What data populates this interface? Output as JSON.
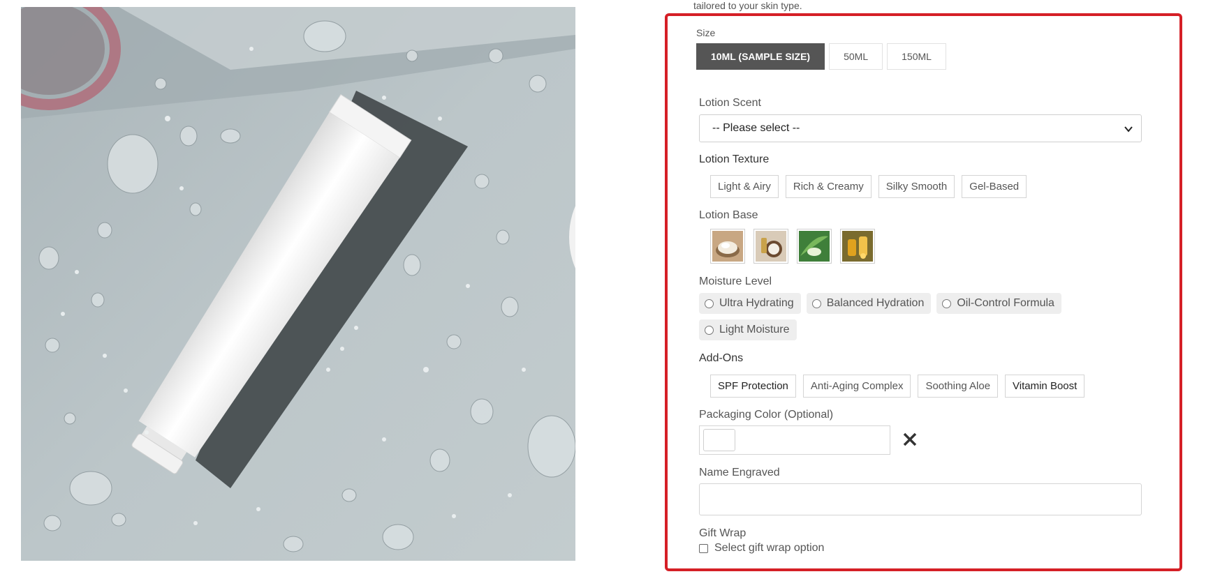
{
  "product": {
    "intro_text": "tailored to your skin type.",
    "image_alt": "White lotion tube on a wet grey surface"
  },
  "options": {
    "size": {
      "label": "Size",
      "choices": [
        "10ML (SAMPLE SIZE)",
        "50ML",
        "150ML"
      ],
      "selected": "10ML (SAMPLE SIZE)"
    },
    "scent": {
      "label": "Lotion Scent",
      "value": "-- Please select --"
    },
    "texture": {
      "label": "Lotion Texture",
      "choices": [
        "Light & Airy",
        "Rich & Creamy",
        "Silky Smooth",
        "Gel-Based"
      ]
    },
    "base": {
      "label": "Lotion Base",
      "swatches": [
        "shea-butter-swatch",
        "coconut-swatch",
        "aloe-vera-swatch",
        "oil-blend-swatch"
      ]
    },
    "moisture": {
      "label": "Moisture Level",
      "choices": [
        "Ultra Hydrating",
        "Balanced Hydration",
        "Oil-Control Formula",
        "Light Moisture"
      ]
    },
    "addons": {
      "label": "Add-Ons",
      "choices": [
        "SPF Protection",
        "Anti-Aging Complex",
        "Soothing Aloe",
        "Vitamin Boost"
      ]
    },
    "packaging_color": {
      "label": "Packaging Color (Optional)"
    },
    "engraving": {
      "label": "Name Engraved",
      "value": ""
    },
    "gift_wrap": {
      "label": "Gift Wrap",
      "option": "Select gift wrap option"
    }
  },
  "colors": {
    "highlight_border": "#d51f26",
    "selected_button": "#555555"
  }
}
